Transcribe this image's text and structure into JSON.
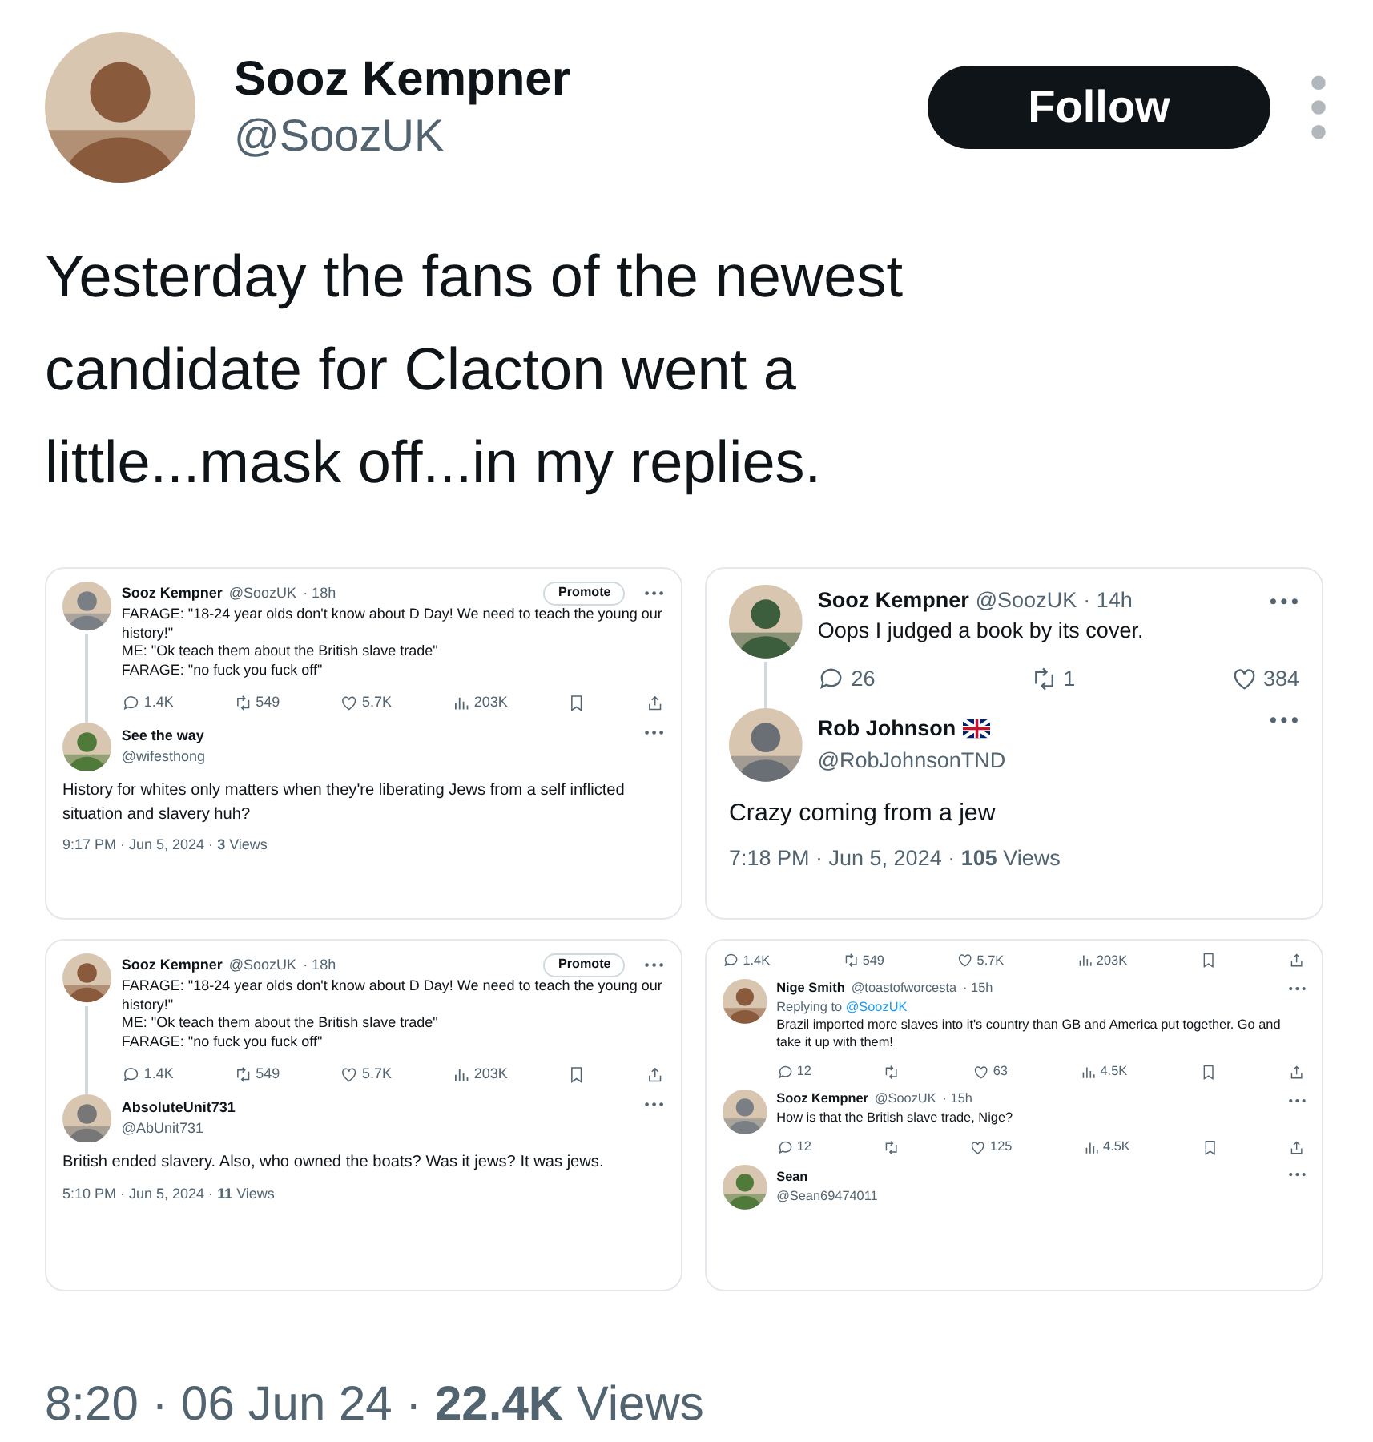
{
  "tweet": {
    "author": {
      "name": "Sooz Kempner",
      "handle": "@SoozUK"
    },
    "follow_button": "Follow",
    "text": "Yesterday the fans of the newest candidate for Clacton went a little...mask off...in my replies.",
    "media": [
      {
        "posts": [
          {
            "kind": "inline",
            "name": "Sooz Kempner",
            "handle": "@SoozUK",
            "time": "· 18h",
            "promote": "Promote",
            "thread_line": true,
            "text": "FARAGE: \"18-24 year olds don't know about D Day! We need to teach the young our history!\"\nME: \"Ok teach them about the British slave trade\"\nFARAGE: \"no fuck you fuck off\"",
            "stats": [
              {
                "kind": "reply",
                "value": "1.4K"
              },
              {
                "kind": "repost",
                "value": "549"
              },
              {
                "kind": "like",
                "value": "5.7K"
              },
              {
                "kind": "views",
                "value": "203K"
              },
              {
                "kind": "bookmark"
              },
              {
                "kind": "share"
              }
            ]
          },
          {
            "kind": "stacked",
            "name": "See the way",
            "handle": "@wifesthong",
            "text": "History for whites only matters when they're liberating Jews from a self inflicted situation and slavery huh?",
            "footer": "9:17 PM · Jun 5, 2024 · **3** Views"
          }
        ]
      },
      {
        "posts": [
          {
            "kind": "inline",
            "name": "Sooz Kempner",
            "handle": "@SoozUK",
            "time": "· 14h",
            "thread_line": true,
            "text": "Oops I judged a book by its cover.",
            "stats": [
              {
                "kind": "reply",
                "value": "26"
              },
              {
                "kind": "repost",
                "value": "1"
              },
              {
                "kind": "like",
                "value": "384"
              }
            ]
          },
          {
            "kind": "stacked",
            "name": "Rob Johnson",
            "flag": true,
            "handle": "@RobJohnsonTND",
            "text": "Crazy coming from a jew",
            "footer": "7:18 PM · Jun 5, 2024 · **105** Views"
          }
        ]
      },
      {
        "posts": [
          {
            "kind": "inline",
            "name": "Sooz Kempner",
            "handle": "@SoozUK",
            "time": "· 18h",
            "promote": "Promote",
            "thread_line": true,
            "text": "FARAGE: \"18-24 year olds don't know about D Day! We need to teach the young our history!\"\nME: \"Ok teach them about the British slave trade\"\nFARAGE: \"no fuck you fuck off\"",
            "stats": [
              {
                "kind": "reply",
                "value": "1.4K"
              },
              {
                "kind": "repost",
                "value": "549"
              },
              {
                "kind": "like",
                "value": "5.7K"
              },
              {
                "kind": "views",
                "value": "203K"
              },
              {
                "kind": "bookmark"
              },
              {
                "kind": "share"
              }
            ]
          },
          {
            "kind": "stacked",
            "name": "AbsoluteUnit731",
            "handle": "@AbUnit731",
            "text": "British ended slavery. Also, who owned the boats? Was it jews? It was jews.",
            "footer": "5:10 PM · Jun 5, 2024 · **11** Views"
          }
        ]
      },
      {
        "posts": [
          {
            "kind": "stats-only",
            "stats": [
              {
                "kind": "reply",
                "value": "1.4K"
              },
              {
                "kind": "repost",
                "value": "549"
              },
              {
                "kind": "like",
                "value": "5.7K"
              },
              {
                "kind": "views",
                "value": "203K"
              },
              {
                "kind": "bookmark"
              },
              {
                "kind": "share"
              }
            ]
          },
          {
            "kind": "inline",
            "name": "Nige Smith",
            "handle": "@toastofworcesta",
            "time": "· 15h",
            "replying_to": {
              "label": "Replying to",
              "handle": "@SoozUK"
            },
            "text": "Brazil imported more slaves into it's country than GB and America put together. Go and take it up with them!",
            "stats": [
              {
                "kind": "reply",
                "value": "12"
              },
              {
                "kind": "repost"
              },
              {
                "kind": "like",
                "value": "63"
              },
              {
                "kind": "views",
                "value": "4.5K"
              },
              {
                "kind": "bookmark"
              },
              {
                "kind": "share"
              }
            ]
          },
          {
            "kind": "inline",
            "name": "Sooz Kempner",
            "handle": "@SoozUK",
            "time": "· 15h",
            "text": "How is that the British slave trade, Nige?",
            "stats": [
              {
                "kind": "reply",
                "value": "12"
              },
              {
                "kind": "repost"
              },
              {
                "kind": "like",
                "value": "125"
              },
              {
                "kind": "views",
                "value": "4.5K"
              },
              {
                "kind": "bookmark"
              },
              {
                "kind": "share"
              }
            ]
          },
          {
            "kind": "stacked",
            "name": "Sean",
            "handle": "@Sean69474011"
          }
        ]
      }
    ],
    "footer": "8:20 · 06 Jun 24 · **22.4K** Views"
  }
}
